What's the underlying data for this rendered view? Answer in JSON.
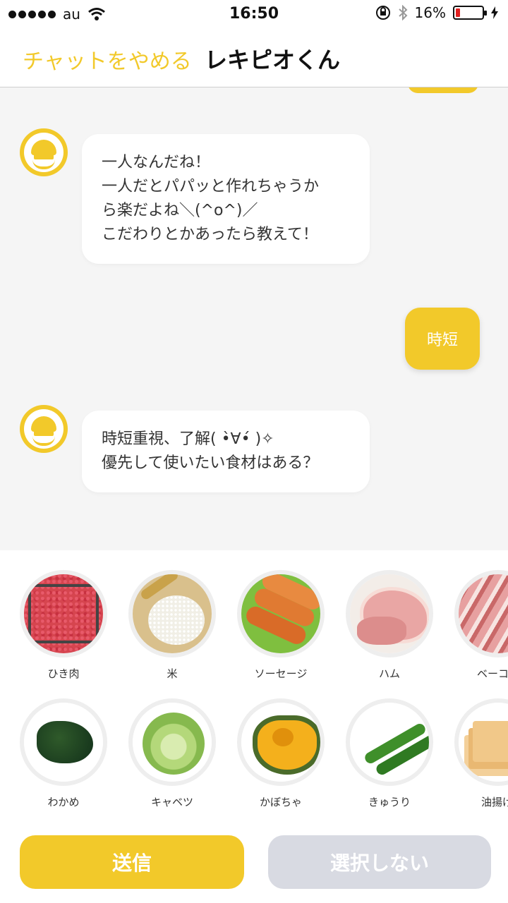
{
  "status_bar": {
    "carrier": "au",
    "time": "16:50",
    "battery_percent": "16%",
    "battery_level": 0.16,
    "battery_color": "#e02020"
  },
  "header": {
    "quit_label": "チャットをやめる",
    "title": "レキピオくん"
  },
  "chat": {
    "messages": [
      {
        "from": "bot",
        "text": "一人なんだね！\n一人だとパパッと作れちゃうか\nら楽だよね＼(^o^)／\nこだわりとかあったら教えて！"
      },
      {
        "from": "user",
        "text": "時短"
      },
      {
        "from": "bot",
        "text": "時短重視、了解( •̀∀•́ )✧\n優先して使いたい食材はある？"
      }
    ]
  },
  "ingredients": {
    "row1": [
      "ひき肉",
      "米",
      "ソーセージ",
      "ハム",
      "ベーコ"
    ],
    "row2": [
      "わかめ",
      "キャベツ",
      "かぼちゃ",
      "きゅうり",
      "油揚げ"
    ]
  },
  "buttons": {
    "send": "送信",
    "none": "選択しない"
  },
  "colors": {
    "accent": "#f2c92a",
    "chat_bg": "#f5f5f5",
    "disabled_button": "#d8dae2"
  }
}
